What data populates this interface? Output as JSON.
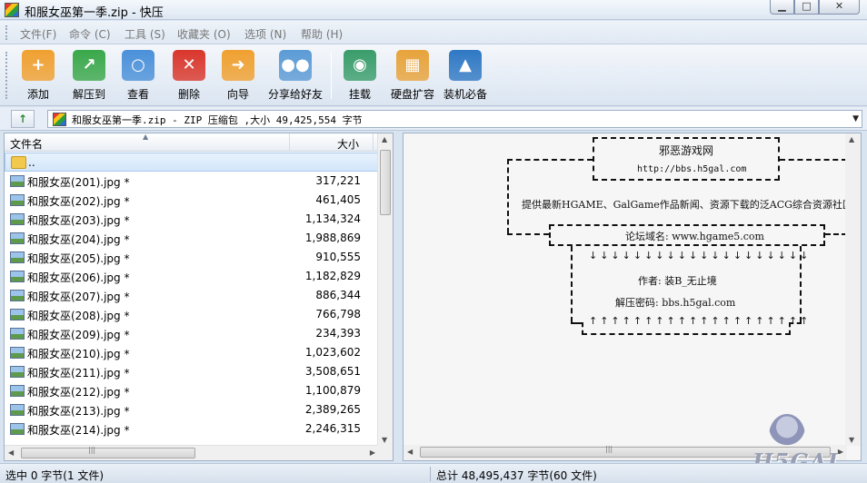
{
  "window": {
    "title": "和服女巫第一季.zip - 快压",
    "min_glyph": "▁",
    "max_glyph": "□",
    "close_glyph": "✕"
  },
  "menu": {
    "items": [
      "文件(F)",
      "命令 (C)",
      "工具 (S)",
      "收藏夹 (O)",
      "选项 (N)",
      "帮助 (H)"
    ]
  },
  "toolbar": {
    "buttons": [
      {
        "label": "添加",
        "icon": "add-archive-icon",
        "color": "#f0a030",
        "glyph": "+"
      },
      {
        "label": "解压到",
        "icon": "extract-to-icon",
        "color": "#3aa84a",
        "glyph": "↗"
      },
      {
        "label": "查看",
        "icon": "view-magnifier-icon",
        "color": "#4a90d9",
        "glyph": "○"
      },
      {
        "label": "删除",
        "icon": "delete-icon",
        "color": "#d9362b",
        "glyph": "✕"
      },
      {
        "label": "向导",
        "icon": "wizard-arrow-icon",
        "color": "#f0a030",
        "glyph": "➜"
      },
      {
        "label": "分享给好友",
        "icon": "share-friends-icon",
        "color": "#5b9bd5",
        "glyph": "●●"
      },
      {
        "label": "挂载",
        "icon": "mount-disk-icon",
        "color": "#3a9d6a",
        "glyph": "◉"
      },
      {
        "label": "硬盘扩容",
        "icon": "disk-expand-icon",
        "color": "#e8a33a",
        "glyph": "▦"
      },
      {
        "label": "装机必备",
        "icon": "essentials-icon",
        "color": "#2f78c4",
        "glyph": "▲"
      }
    ]
  },
  "address": {
    "up_glyph": "↑",
    "path": "和服女巫第一季.zip - ZIP 压缩包 ,大小 49,425,554 字节",
    "dropdown_glyph": "▼"
  },
  "file_list": {
    "header_name": "文件名",
    "header_size": "大小",
    "parent_label": "..",
    "rows": [
      {
        "name": "和服女巫(201).jpg *",
        "size": "317,221"
      },
      {
        "name": "和服女巫(202).jpg *",
        "size": "461,405"
      },
      {
        "name": "和服女巫(203).jpg *",
        "size": "1,134,324"
      },
      {
        "name": "和服女巫(204).jpg *",
        "size": "1,988,869"
      },
      {
        "name": "和服女巫(205).jpg *",
        "size": "910,555"
      },
      {
        "name": "和服女巫(206).jpg *",
        "size": "1,182,829"
      },
      {
        "name": "和服女巫(207).jpg *",
        "size": "886,344"
      },
      {
        "name": "和服女巫(208).jpg *",
        "size": "766,798"
      },
      {
        "name": "和服女巫(209).jpg *",
        "size": "234,393"
      },
      {
        "name": "和服女巫(210).jpg *",
        "size": "1,023,602"
      },
      {
        "name": "和服女巫(211).jpg *",
        "size": "3,508,651"
      },
      {
        "name": "和服女巫(212).jpg *",
        "size": "1,100,879"
      },
      {
        "name": "和服女巫(213).jpg *",
        "size": "2,389,265"
      },
      {
        "name": "和服女巫(214).jpg *",
        "size": "2,246,315"
      }
    ]
  },
  "preview": {
    "site_name": "邪恶游戏网",
    "site_url": "http://bbs.h5gal.com",
    "description": "提供最新HGAME、GalGame作品新闻、资源下载的泛ACG综合资源社区",
    "forum_domain": "论坛域名: www.hgame5.com",
    "author": "作者: 装B_无止境",
    "password": "解压密码: bbs.h5gal.com",
    "down_arrows": "↓↓↓↓↓↓↓↓↓↓↓↓↓↓↓↓↓↓↓↓",
    "up_arrows": "↑↑↑↑↑↑↑↑↑↑↑↑↑↑↑↑↑↑↑↑"
  },
  "watermark": {
    "text": "H5GAL"
  },
  "status": {
    "left": "选中  0 字节(1 文件)",
    "right": "总计  48,495,437 字节(60 文件)"
  }
}
